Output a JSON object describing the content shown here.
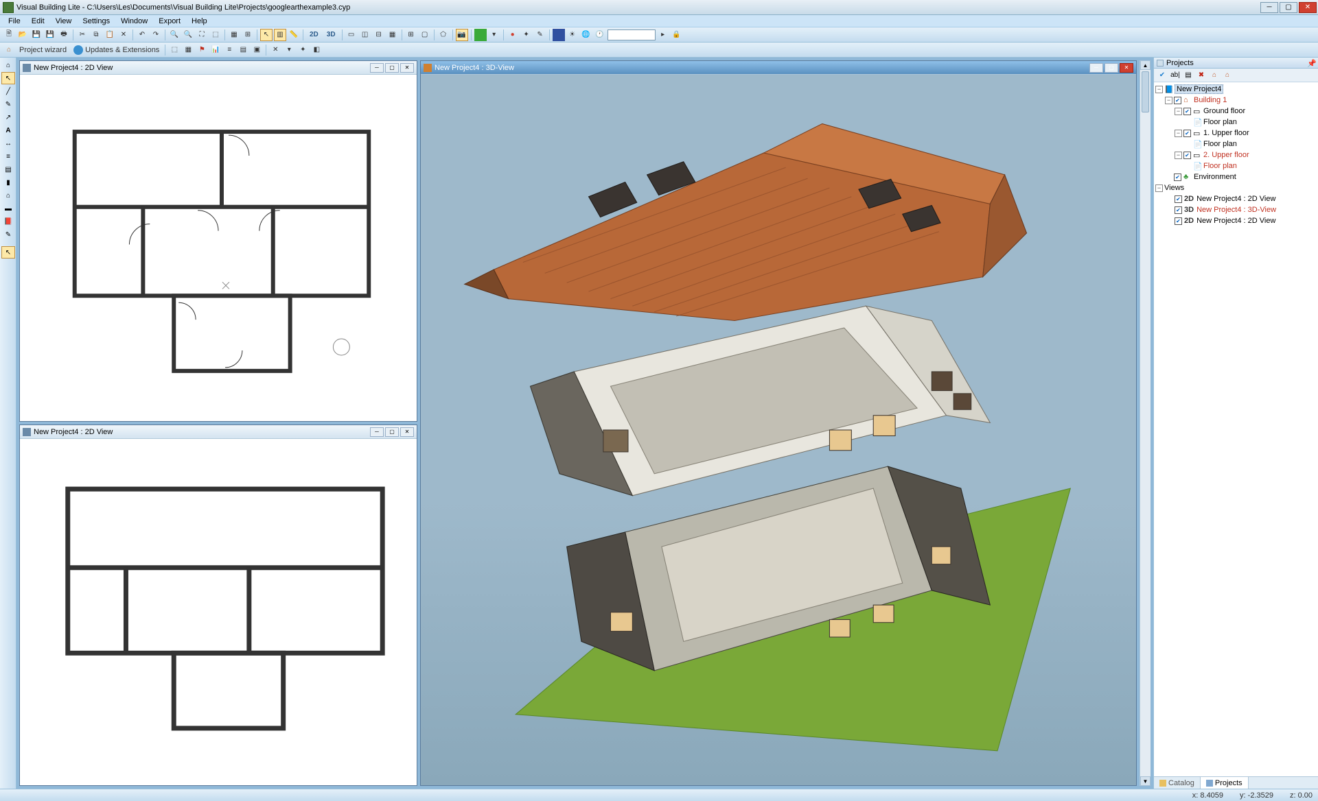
{
  "title": "Visual Building Lite - C:\\Users\\Les\\Documents\\Visual Building Lite\\Projects\\googlearthexample3.cyp",
  "menu": [
    "File",
    "Edit",
    "View",
    "Settings",
    "Window",
    "Export",
    "Help"
  ],
  "toolbar2": {
    "project_wizard": "Project wizard",
    "updates": "Updates & Extensions"
  },
  "views": {
    "v1": "New Project4 : 2D View",
    "v2": "New Project4 : 2D View",
    "v3": "New Project4 : 3D-View"
  },
  "projects_panel": {
    "title": "Projects",
    "root": "New Project4",
    "building": "Building 1",
    "ground_floor": "Ground floor",
    "floor_plan": "Floor plan",
    "upper1": "1. Upper floor",
    "upper2": "2. Upper floor",
    "environment": "Environment",
    "views_label": "Views",
    "view_rows": [
      {
        "prefix": "2D",
        "label": "New Project4 : 2D View"
      },
      {
        "prefix": "3D",
        "label": "New Project4 : 3D-View"
      },
      {
        "prefix": "2D",
        "label": "New Project4 : 2D View"
      }
    ],
    "tabs": {
      "catalog": "Catalog",
      "projects": "Projects"
    }
  },
  "status": {
    "x": "x: 8.4059",
    "y": "y: -2.3529",
    "z": "z: 0.00"
  }
}
